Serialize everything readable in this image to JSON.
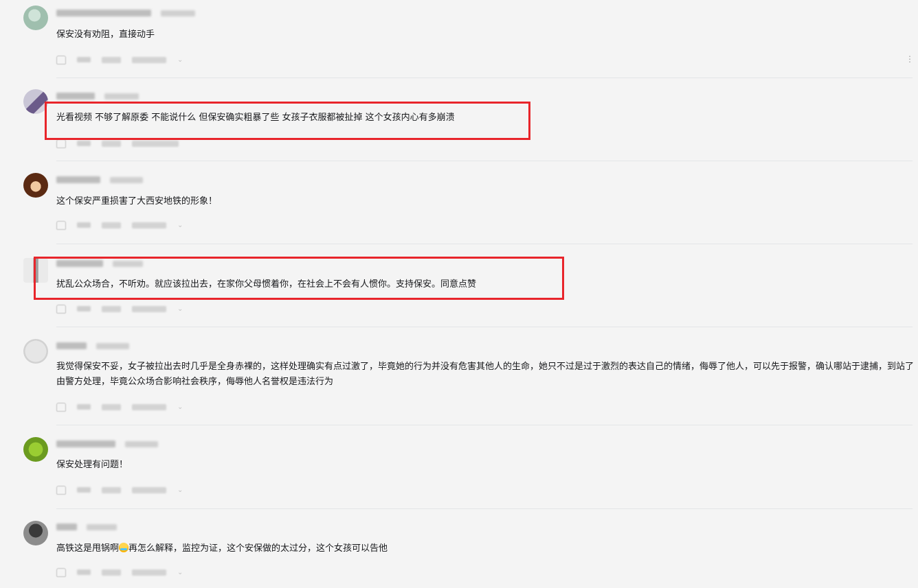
{
  "comments": [
    {
      "text": "保安没有劝阻，直接动手"
    },
    {
      "text": "光看视频 不够了解原委 不能说什么 但保安确实粗暴了些 女孩子衣服都被扯掉 这个女孩内心有多崩溃"
    },
    {
      "text": "这个保安严重损害了大西安地铁的形象！"
    },
    {
      "text": "扰乱公众场合，不听劝。就应该拉出去，在家你父母惯着你，在社会上不会有人惯你。支持保安。同意点赞"
    },
    {
      "text": "我觉得保安不妥，女子被拉出去时几乎是全身赤裸的，这样处理确实有点过激了，毕竟她的行为并没有危害其他人的生命，她只不过是过于激烈的表达自己的情绪，侮辱了他人，可以先于报警，确认哪站于逮捕，到站了由警方处理，毕竟公众场合影响社会秩序，侮辱他人名誉权是违法行为"
    },
    {
      "text": "保安处理有问题！"
    },
    {
      "text_a": "高铁这是甩锅啊",
      "emoji": "laughing-crying-emoji",
      "text_b": "再怎么解释，监控为证，这个安保做的太过分，这个女孩可以告他"
    }
  ],
  "more_icon": "⋮",
  "highlight_color": "#e8252b"
}
